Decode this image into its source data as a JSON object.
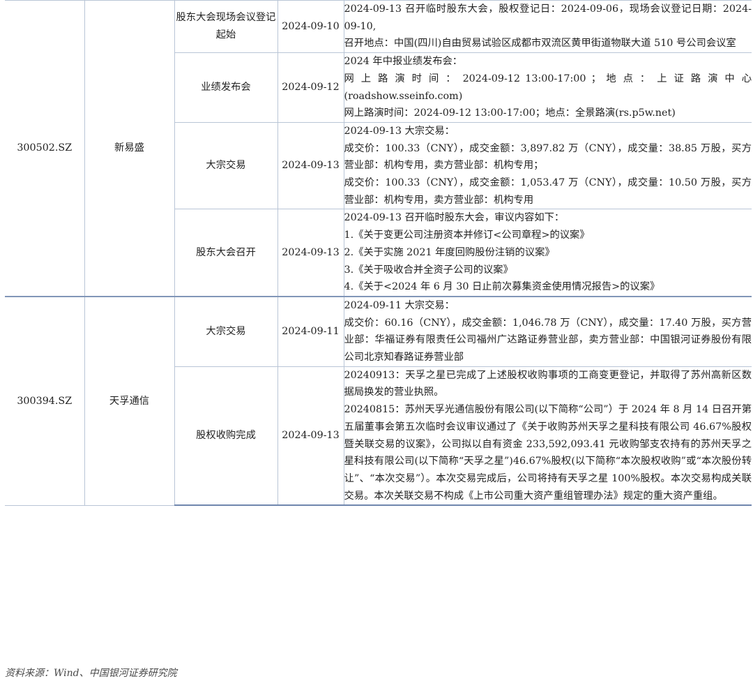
{
  "groups": [
    {
      "code": "300502.SZ",
      "name": "新易盛",
      "events": [
        {
          "type": "股东大会现场会议登记起始",
          "date": "2024-09-10",
          "lines": [
            "2024-09-13 召开临时股东大会，股权登记日：2024-09-06，现场会议登记日期：2024-09-10,",
            "召开地点：中国(四川)自由贸易试验区成都市双流区黄甲街道物联大道 510 号公司会议室"
          ]
        },
        {
          "type": "业绩发布会",
          "date": "2024-09-12",
          "lines": [
            "2024 年中报业绩发布会：",
            "网 上 路 演 时 间 ： 2024-09-12  13:00-17:00 ； 地 点 ： 上 证 路 演 中 心 (roadshow.sseinfo.com)",
            "网上路演时间：2024-09-12 13:00-17:00；地点：全景路演(rs.p5w.net)"
          ]
        },
        {
          "type": "大宗交易",
          "date": "2024-09-13",
          "lines": [
            "2024-09-13 大宗交易：",
            "成交价：100.33（CNY），成交金额：3,897.82 万（CNY），成交量：38.85 万股，买方营业部：机构专用，卖方营业部：机构专用；",
            "成交价：100.33（CNY），成交金额：1,053.47 万（CNY），成交量：10.50 万股，买方营业部：机构专用，卖方营业部：机构专用"
          ]
        },
        {
          "type": "股东大会召开",
          "date": "2024-09-13",
          "lines": [
            "2024-09-13 召开临时股东大会，审议内容如下：",
            "1.《关于变更公司注册资本并修订<公司章程>的议案》",
            "2.《关于实施 2021 年度回购股份注销的议案》",
            "3.《关于吸收合并全资子公司的议案》",
            "4.《关于<2024 年 6 月 30 日止前次募集资金使用情况报告>的议案》"
          ]
        }
      ]
    },
    {
      "code": "300394.SZ",
      "name": "天孚通信",
      "events": [
        {
          "type": "大宗交易",
          "date": "2024-09-11",
          "lines": [
            "2024-09-11 大宗交易：",
            "成交价：60.16（CNY），成交金额：1,046.78 万（CNY），成交量：17.40 万股，买方营业部：华福证券有限责任公司福州广达路证券营业部，卖方营业部：中国银河证券股份有限公司北京知春路证券营业部"
          ]
        },
        {
          "type": "股权收购完成",
          "date": "2024-09-13",
          "lines": [
            "20240913：天孚之星已完成了上述股权收购事项的工商变更登记，并取得了苏州高新区数据局换发的营业执照。",
            "20240815：苏州天孚光通信股份有限公司(以下简称“公司”）于 2024 年 8 月 14 日召开第五届董事会第五次临时会议审议通过了《关于收购苏州天孚之星科技有限公司 46.67%股权暨关联交易的议案》，公司拟以自有资金 233,592,093.41 元收购邹支农持有的苏州天孚之星科技有限公司(以下简称“天孚之星”)46.67%股权(以下简称“本次股权收购”或“本次股份转让”、“本次交易”）。本次交易完成后，公司将持有天孚之星 100%股权。本次交易构成关联交易。本次关联交易不构成《上市公司重大资产重组管理办法》规定的重大资产重组。"
          ]
        }
      ]
    }
  ],
  "source": "资料来源：Wind、中国银河证券研究院"
}
